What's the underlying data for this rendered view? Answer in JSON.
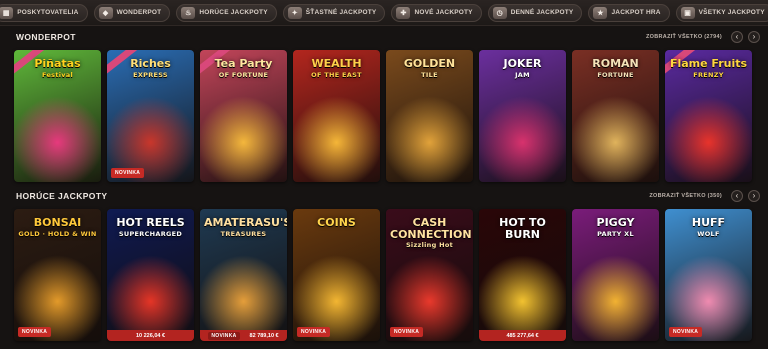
{
  "nav": {
    "tabs": [
      {
        "label": "POSKYTOVATELIA",
        "icon": "providers-icon"
      },
      {
        "label": "WONDERPOT",
        "icon": "wonderpot-icon"
      },
      {
        "label": "HORÚCE JACKPOTY",
        "icon": "hot-jackpot-icon"
      },
      {
        "label": "ŠŤASTNÉ JACKPOTY",
        "icon": "lucky-jackpot-icon"
      },
      {
        "label": "NOVÉ JACKPOTY",
        "icon": "new-jackpot-icon"
      },
      {
        "label": "DENNÉ JACKPOTY",
        "icon": "daily-jackpot-icon"
      },
      {
        "label": "JACKPOT HRA",
        "icon": "jackpot-game-icon"
      },
      {
        "label": "VŠETKY JACKPOTY",
        "icon": "all-jackpots-icon"
      }
    ]
  },
  "sections": [
    {
      "title": "WONDERPOT",
      "view_all": "ZOBRAZIŤ VŠETKO (2794)",
      "games": [
        {
          "title": "Piñatas",
          "subtitle": "Festival",
          "color": "#5fb83a",
          "accent": "#e7397d",
          "text_color": "#ffd21e",
          "badge": ""
        },
        {
          "title": "Riches",
          "subtitle": "EXPRESS",
          "color": "#2a6db4",
          "accent": "#c9362b",
          "text_color": "#ffe07a",
          "badge": "NOVINKA"
        },
        {
          "title": "Tea Party",
          "subtitle": "OF FORTUNE",
          "color": "#c2455a",
          "accent": "#f4b73c",
          "text_color": "#ffe6a0",
          "badge": ""
        },
        {
          "title": "WEALTH",
          "subtitle": "OF THE EAST",
          "color": "#b3261e",
          "accent": "#f5b638",
          "text_color": "#ffd04a",
          "badge": ""
        },
        {
          "title": "GOLDEN",
          "subtitle": "TILE",
          "color": "#7a4a1c",
          "accent": "#e1a23a",
          "text_color": "#ffe39a",
          "badge": ""
        },
        {
          "title": "JOKER",
          "subtitle": "JAM",
          "color": "#6b2f9e",
          "accent": "#d8326d",
          "text_color": "#ffffff",
          "badge": ""
        },
        {
          "title": "ROMAN",
          "subtitle": "FORTUNE",
          "color": "#7a2f24",
          "accent": "#e0b35c",
          "text_color": "#f5e2b8",
          "badge": ""
        },
        {
          "title": "Flame Fruits",
          "subtitle": "FRENZY",
          "color": "#5a2aa0",
          "accent": "#e8332b",
          "text_color": "#ffd640",
          "badge": ""
        }
      ]
    },
    {
      "title": "HORÚCE JACKPOTY",
      "view_all": "ZOBRAZIŤ VŠETKO (350)",
      "games": [
        {
          "title": "BONSAI",
          "subtitle": "GOLD · HOLD & WIN",
          "color": "#2c1c12",
          "accent": "#e39a2a",
          "text_color": "#ffc83a",
          "badge": "NOVINKA",
          "jackpot": ""
        },
        {
          "title": "HOT REELS",
          "subtitle": "SUPERCHARGED",
          "color": "#0f1a52",
          "accent": "#e53526",
          "text_color": "#ffffff",
          "badge": "",
          "jackpot": "10 226,04 €"
        },
        {
          "title": "AMATERASU'S",
          "subtitle": "TREASURES",
          "color": "#1f3a52",
          "accent": "#e59e3a",
          "text_color": "#ffe0a0",
          "badge": "NOVINKA",
          "jackpot": "82 789,10 €"
        },
        {
          "title": "COINS",
          "subtitle": "",
          "color": "#6a3a0e",
          "accent": "#f3b632",
          "text_color": "#ffd44c",
          "badge": "NOVINKA",
          "jackpot": ""
        },
        {
          "title": "CASH CONNECTION",
          "subtitle": "Sizzling Hot",
          "color": "#3a0c1a",
          "accent": "#e9392c",
          "text_color": "#ffe2a0",
          "badge": "NOVINKA",
          "jackpot": ""
        },
        {
          "title": "HOT TO BURN",
          "subtitle": "",
          "color": "#2a0608",
          "accent": "#f2c230",
          "text_color": "#ffffff",
          "badge": "",
          "jackpot": "485 277,64 €"
        },
        {
          "title": "PIGGY",
          "subtitle": "PARTY XL",
          "color": "#7a1c7a",
          "accent": "#f2b232",
          "text_color": "#ffffff",
          "badge": "",
          "jackpot": ""
        },
        {
          "title": "HUFF",
          "subtitle": "WOLF",
          "color": "#3f8fd0",
          "accent": "#f08bb0",
          "text_color": "#ffffff",
          "badge": "NOVINKA",
          "jackpot": ""
        }
      ]
    }
  ]
}
